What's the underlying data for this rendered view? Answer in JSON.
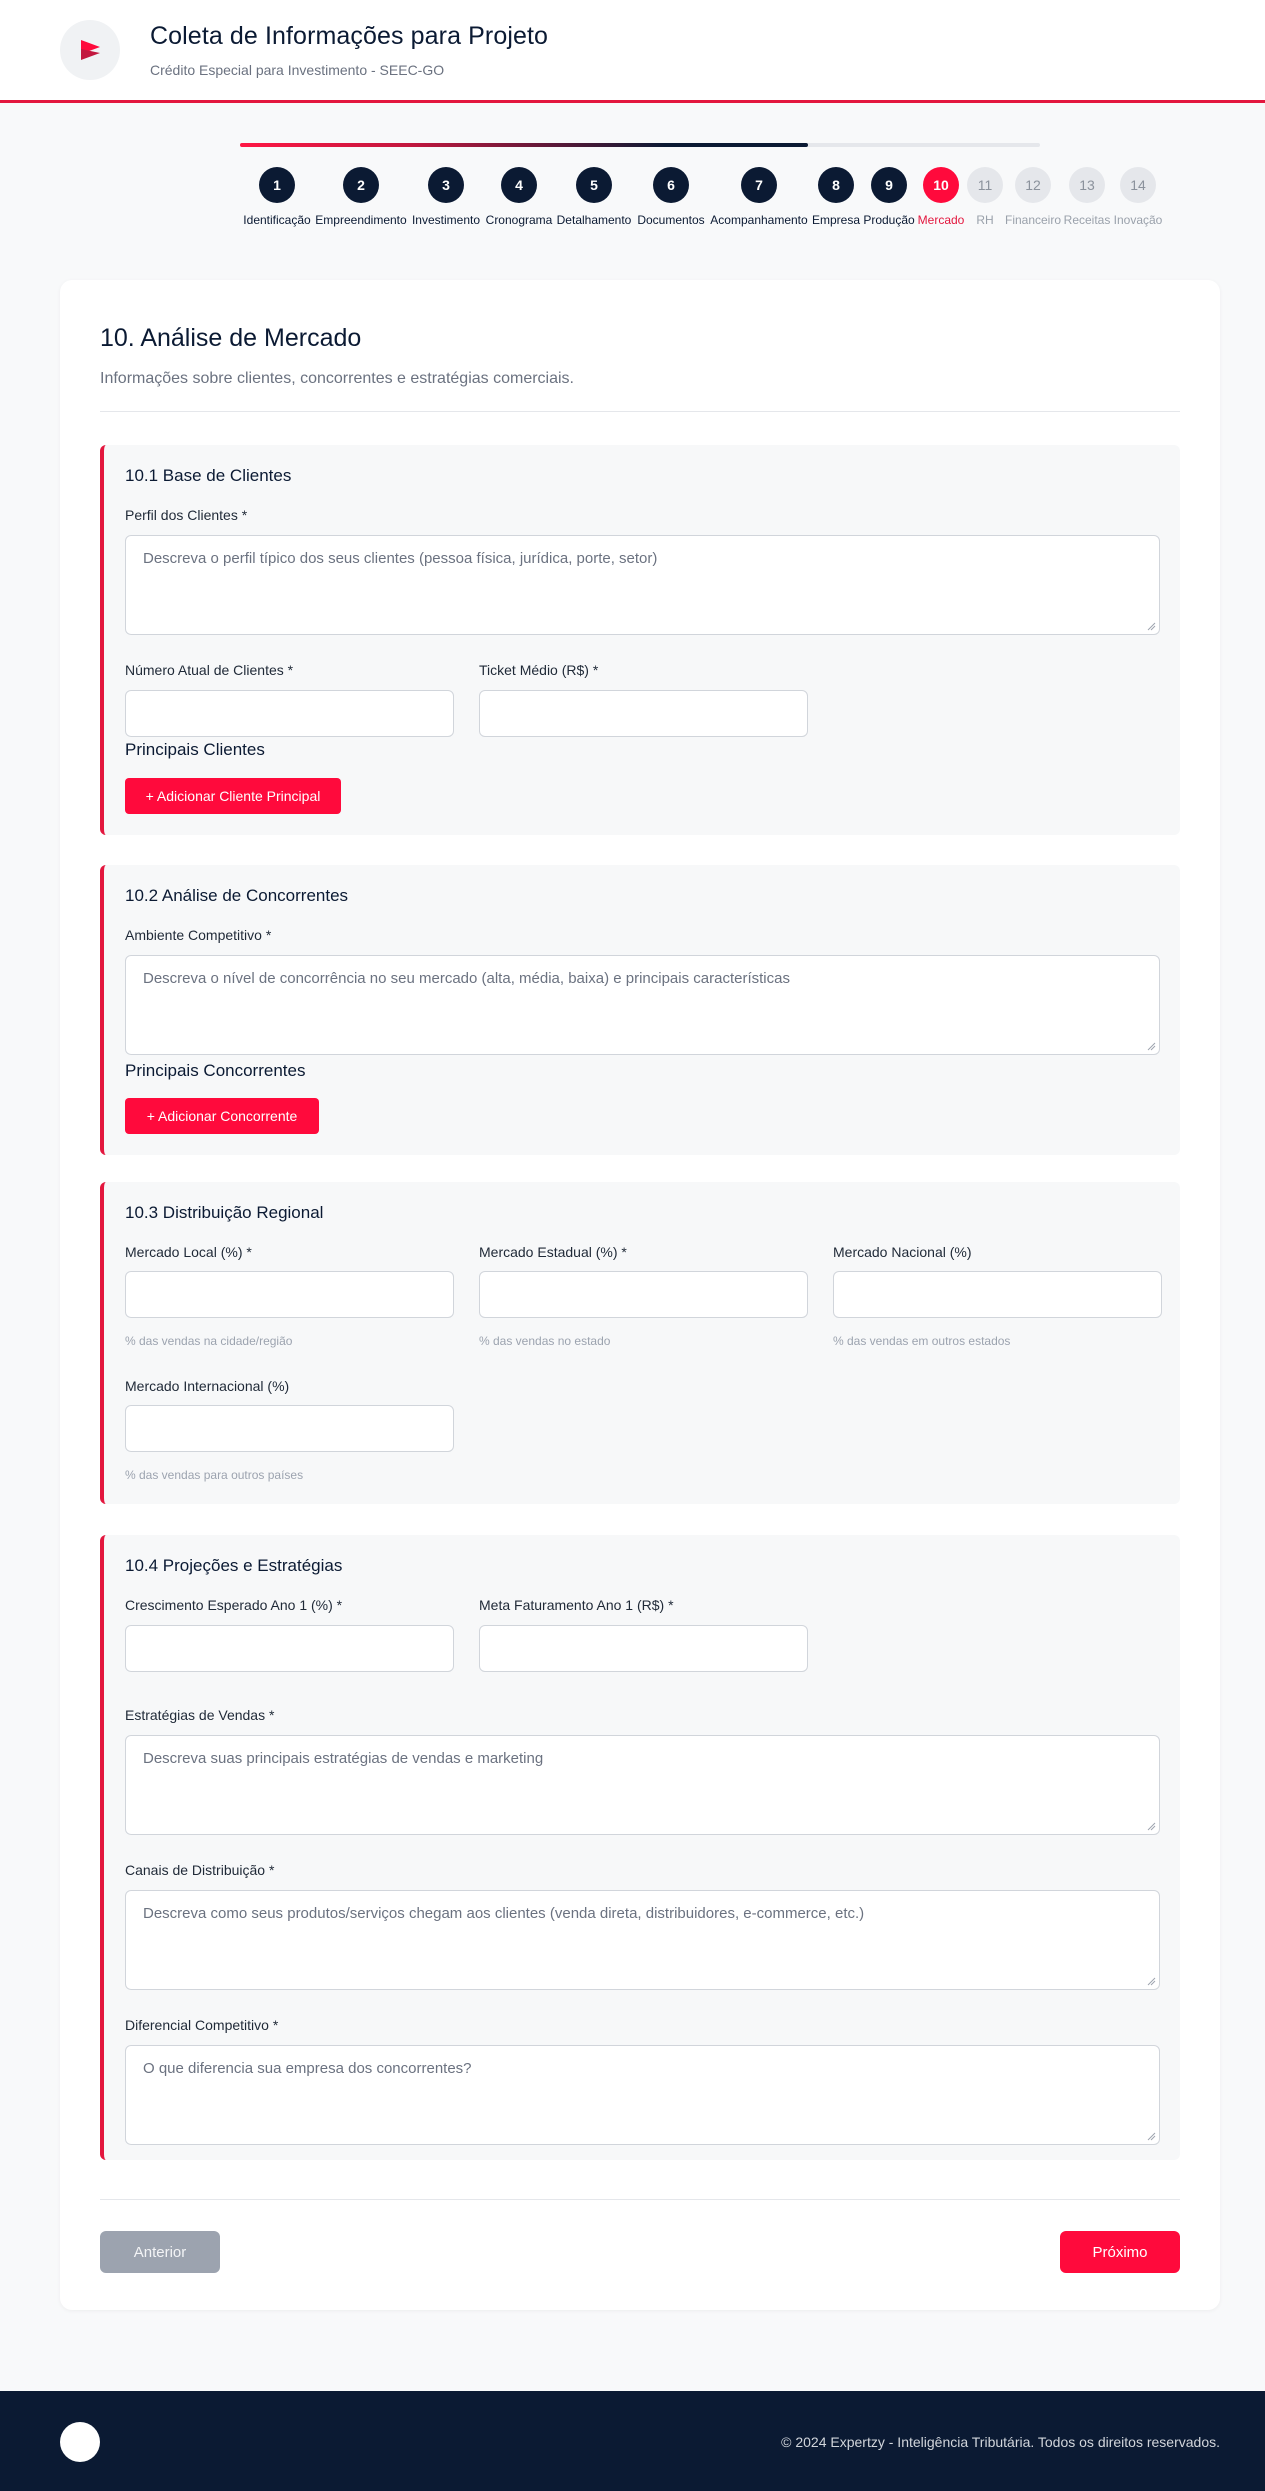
{
  "header": {
    "title": "Coleta de Informações para Projeto",
    "subtitle": "Crédito Especial para Investimento - SEEC-GO",
    "logo_icon": "play-logo-icon",
    "accent": "#e3173e"
  },
  "stepper": {
    "progress_percent": 71,
    "steps": [
      {
        "number": "1",
        "label": "Identificação",
        "state": "done"
      },
      {
        "number": "2",
        "label": "Empreendimento",
        "state": "done"
      },
      {
        "number": "3",
        "label": "Investimento",
        "state": "done"
      },
      {
        "number": "4",
        "label": "Cronograma",
        "state": "done"
      },
      {
        "number": "5",
        "label": "Detalhamento",
        "state": "done"
      },
      {
        "number": "6",
        "label": "Documentos",
        "state": "done"
      },
      {
        "number": "7",
        "label": "Acompanhamento",
        "state": "done"
      },
      {
        "number": "8",
        "label": "Empresa",
        "state": "done"
      },
      {
        "number": "9",
        "label": "Produção",
        "state": "done"
      },
      {
        "number": "10",
        "label": "Mercado",
        "state": "current"
      },
      {
        "number": "11",
        "label": "RH",
        "state": "future"
      },
      {
        "number": "12",
        "label": "Financeiro",
        "state": "future"
      },
      {
        "number": "13",
        "label": "Receitas",
        "state": "future"
      },
      {
        "number": "14",
        "label": "Inovação",
        "state": "future"
      }
    ]
  },
  "form": {
    "title": "10. Análise de Mercado",
    "description": "Informações sobre clientes, concorrentes e estratégias comerciais.",
    "s1": {
      "title": "10.1 Base de Clientes",
      "perfil_label": "Perfil dos Clientes *",
      "perfil_placeholder": "Descreva o perfil típico dos seus clientes (pessoa física, jurídica, porte, setor)",
      "numero_label": "Número Atual de Clientes *",
      "numero_value": "",
      "ticket_label": "Ticket Médio (R$) *",
      "ticket_value": "",
      "principais_heading": "Principais Clientes",
      "add_button": "+ Adicionar Cliente Principal"
    },
    "s2": {
      "title": "10.2 Análise de Concorrentes",
      "ambiente_label": "Ambiente Competitivo *",
      "ambiente_placeholder": "Descreva o nível de concorrência no seu mercado (alta, média, baixa) e principais características",
      "principais_heading": "Principais Concorrentes",
      "add_button": "+ Adicionar Concorrente"
    },
    "s3": {
      "title": "10.3 Distribuição Regional",
      "local_label": "Mercado Local (%) *",
      "local_hint": "% das vendas na cidade/região",
      "estadual_label": "Mercado Estadual (%) *",
      "estadual_hint": "% das vendas no estado",
      "nacional_label": "Mercado Nacional (%)",
      "nacional_hint": "% das vendas em outros estados",
      "internacional_label": "Mercado Internacional (%)",
      "internacional_hint": "% das vendas para outros países"
    },
    "s4": {
      "title": "10.4 Projeções e Estratégias",
      "crescimento_label": "Crescimento Esperado Ano 1 (%) *",
      "meta_label": "Meta Faturamento Ano 1 (R$) *",
      "estrategias_label": "Estratégias de Vendas *",
      "estrategias_placeholder": "Descreva suas principais estratégias de vendas e marketing",
      "canais_label": "Canais de Distribuição *",
      "canais_placeholder": "Descreva como seus produtos/serviços chegam aos clientes (venda direta, distribuidores, e-commerce, etc.)",
      "diferencial_label": "Diferencial Competitivo *",
      "diferencial_placeholder": "O que diferencia sua empresa dos concorrentes?"
    },
    "nav": {
      "prev": "Anterior",
      "next": "Próximo"
    }
  },
  "footer": {
    "text": "© 2024 Expertzy - Inteligência Tributária. Todos os direitos reservados."
  }
}
